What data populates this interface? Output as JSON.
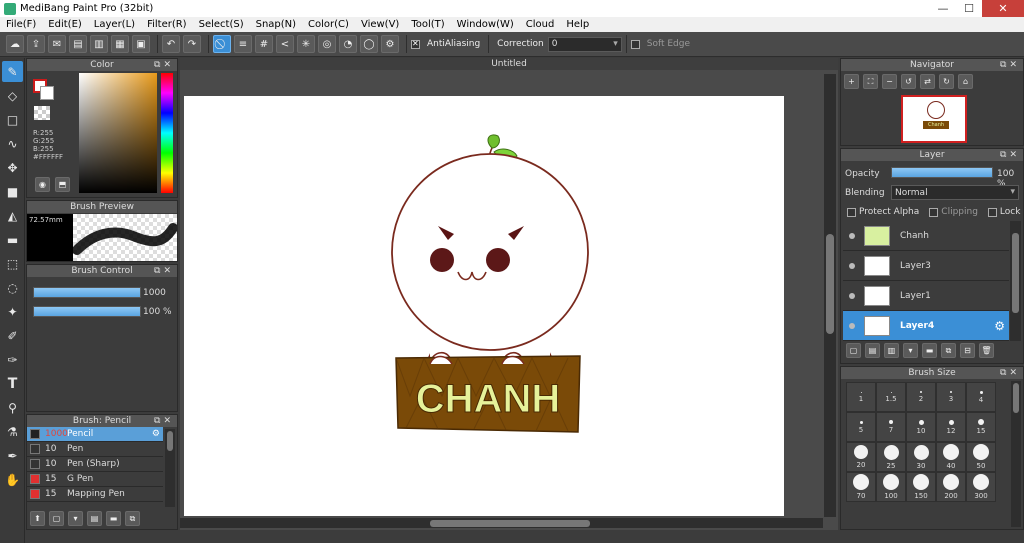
{
  "window": {
    "title": "MediBang Paint Pro (32bit)",
    "minimize": "—",
    "maximize": "☐",
    "close": "✕"
  },
  "menu": [
    "File(F)",
    "Edit(E)",
    "Layer(L)",
    "Filter(R)",
    "Select(S)",
    "Snap(N)",
    "Color(C)",
    "View(V)",
    "Tool(T)",
    "Window(W)",
    "Cloud",
    "Help"
  ],
  "toolbar": {
    "antialiasing_label": "AntiAliasing",
    "correction_label": "Correction",
    "correction_value": "0",
    "soft_edge_label": "Soft Edge"
  },
  "color_panel": {
    "title": "Color",
    "r": "R:255",
    "g": "G:255",
    "b": "B:255",
    "hex": "#FFFFFF",
    "primary_color": "#cc1a1a",
    "secondary_color": "#ffffff"
  },
  "brush_preview": {
    "title": "Brush Preview",
    "size": "72.57mm"
  },
  "brush_control": {
    "title": "Brush Control",
    "size_value": "1000",
    "opacity_value": "100 %",
    "size_level": 1.0,
    "opacity_level": 1.0
  },
  "brush_list": {
    "title": "Brush: Pencil",
    "items": [
      {
        "size": "1000",
        "name": "Pencil",
        "color": "#222222",
        "selected": true
      },
      {
        "size": "10",
        "name": "Pen",
        "color": "#333333"
      },
      {
        "size": "10",
        "name": "Pen (Sharp)",
        "color": "#333333"
      },
      {
        "size": "15",
        "name": "G Pen",
        "color": "#e03030"
      },
      {
        "size": "15",
        "name": "Mapping Pen",
        "color": "#e03030"
      }
    ]
  },
  "document": {
    "tab_title": "Untitled",
    "sign_text": "CHANH"
  },
  "navigator": {
    "title": "Navigator",
    "thumb_text": "Chanh"
  },
  "layer_panel": {
    "title": "Layer",
    "opacity_label": "Opacity",
    "opacity_value": "100 %",
    "opacity_level": 1.0,
    "blending_label": "Blending",
    "blending_value": "Normal",
    "protect_alpha": "Protect Alpha",
    "clipping": "Clipping",
    "lock": "Lock",
    "layers": [
      {
        "name": "Chanh",
        "selected": false
      },
      {
        "name": "Layer3",
        "selected": false
      },
      {
        "name": "Layer1",
        "selected": false
      },
      {
        "name": "Layer4",
        "selected": true
      }
    ]
  },
  "brush_size": {
    "title": "Brush Size",
    "sizes": [
      "1",
      "1.5",
      "2",
      "3",
      "4",
      "5",
      "7",
      "10",
      "12",
      "15",
      "20",
      "25",
      "30",
      "40",
      "50",
      "70",
      "100",
      "150",
      "200",
      "300"
    ]
  }
}
